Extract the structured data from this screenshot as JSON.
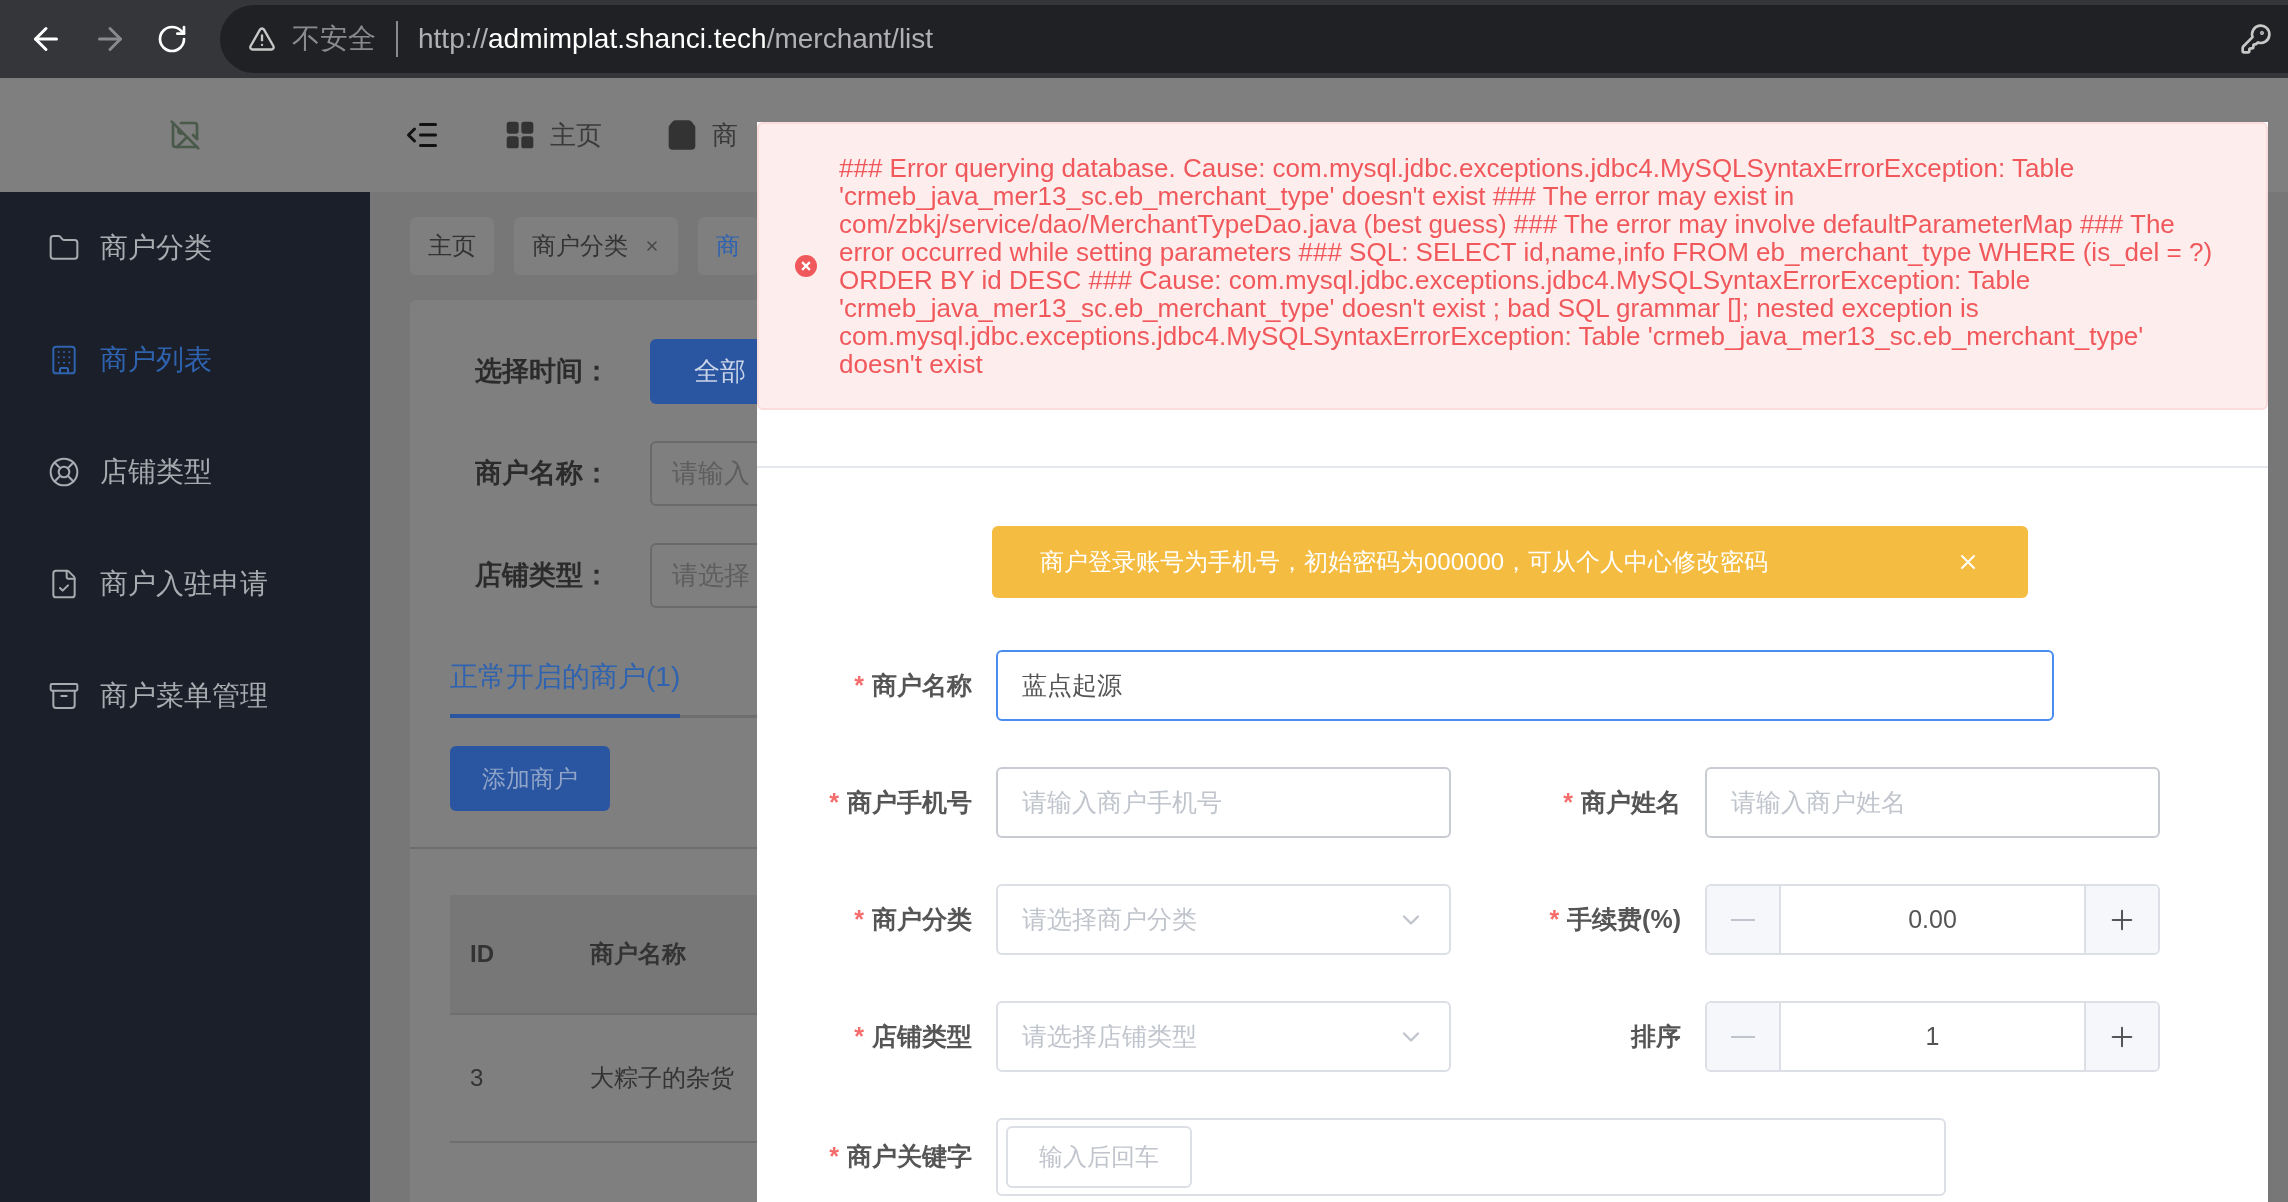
{
  "browser": {
    "security_label": "不安全",
    "url_scheme": "http://",
    "url_host": "admimplat.shanci.tech",
    "url_path": "/merchant/list"
  },
  "header": {
    "nav_items": [
      {
        "label": "主页"
      },
      {
        "label": "商"
      }
    ]
  },
  "sidebar": {
    "items": [
      {
        "label": "商户分类",
        "selected": false
      },
      {
        "label": "商户列表",
        "selected": true
      },
      {
        "label": "店铺类型",
        "selected": false
      },
      {
        "label": "商户入驻申请",
        "selected": false
      },
      {
        "label": "商户菜单管理",
        "selected": false
      }
    ]
  },
  "tags_view": [
    {
      "label": "主页",
      "closable": false,
      "selected": false
    },
    {
      "label": "商户分类",
      "closable": true,
      "selected": false
    },
    {
      "label": "商",
      "closable": false,
      "selected": true
    }
  ],
  "filters": [
    {
      "kind": "button",
      "label": "选择时间：",
      "value": "全部"
    },
    {
      "kind": "input",
      "label": "商户名称：",
      "placeholder": "请输入"
    },
    {
      "kind": "input",
      "label": "店铺类型：",
      "placeholder": "请选择"
    }
  ],
  "status_tabs": [
    {
      "label": "正常开启的商户(1)",
      "selected": true
    }
  ],
  "add_button": "添加商户",
  "table": {
    "columns": [
      "ID",
      "商户名称"
    ],
    "rows": [
      [
        "3",
        "大粽子的杂货"
      ]
    ]
  },
  "error_message": "### Error querying database. Cause: com.mysql.jdbc.exceptions.jdbc4.MySQLSyntaxErrorException: Table 'crmeb_java_mer13_sc.eb_merchant_type' doesn't exist ### The error may exist in com/zbkj/service/dao/MerchantTypeDao.java (best guess) ### The error may involve defaultParameterMap ### The error occurred while setting parameters ### SQL: SELECT id,name,info FROM eb_merchant_type WHERE (is_del = ?) ORDER BY id DESC ### Cause: com.mysql.jdbc.exceptions.jdbc4.MySQLSyntaxErrorException: Table 'crmeb_java_mer13_sc.eb_merchant_type' doesn't exist ; bad SQL grammar []; nested exception is com.mysql.jdbc.exceptions.jdbc4.MySQLSyntaxErrorException: Table 'crmeb_java_mer13_sc.eb_merchant_type' doesn't exist",
  "dialog": {
    "required_mark": "*",
    "notice": {
      "text": "商户登录账号为手机号，初始密码为000000，可从个人中心修改密码",
      "closable": true
    },
    "rows": [
      [
        {
          "kind": "text",
          "label": "商户名称",
          "required": true,
          "value": "蓝点起源",
          "focused": true
        }
      ],
      [
        {
          "kind": "text",
          "label": "商户手机号",
          "required": true,
          "placeholder": "请输入商户手机号",
          "focused": false
        },
        {
          "kind": "text",
          "label": "商户姓名",
          "required": true,
          "placeholder": "请输入商户姓名",
          "focused": false
        }
      ],
      [
        {
          "kind": "select",
          "label": "商户分类",
          "required": true,
          "placeholder": "请选择商户分类"
        },
        {
          "kind": "number",
          "label": "手续费(%)",
          "required": true,
          "value": "0.00"
        }
      ],
      [
        {
          "kind": "select",
          "label": "店铺类型",
          "required": true,
          "placeholder": "请选择店铺类型"
        },
        {
          "kind": "number",
          "label": "排序",
          "required": false,
          "value": "1"
        }
      ],
      [
        {
          "kind": "tags",
          "label": "商户关键字",
          "required": true,
          "placeholder": "输入后回车"
        }
      ]
    ]
  }
}
